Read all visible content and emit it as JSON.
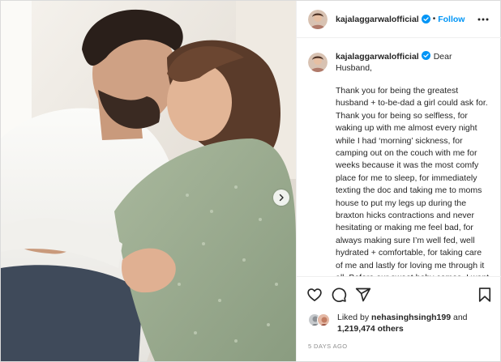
{
  "post": {
    "username": "kajalaggarwalofficial",
    "follow_label": "Follow",
    "separator": "•",
    "caption_greeting": "Dear Husband,",
    "caption_text": "Thank you for being the greatest husband + to-be-dad a girl could ask for. Thank you for being so selfless, for waking up with me almost every night while I had ‘morning’ sickness, for camping out on the couch with me for weeks because it was the most comfy place for me to sleep, for immediately texting the doc and taking me to moms house to put my legs up during the braxton hicks contractions and never hesitating or making me feel bad, for always making sure I’m well fed, well hydrated + comfortable, for taking care of me and lastly for loving me through it all. Before our sweet baby comes, I want",
    "liked_by_prefix": "Liked by",
    "liked_by_user": "nehasinghsingh199",
    "liked_by_and": "and",
    "likes_count": "1,219,474 others",
    "timestamp": "5 DAYS AGO"
  },
  "colors": {
    "accent": "#0095f6",
    "text": "#262626",
    "muted": "#8e8e8e",
    "border": "#dbdbdb"
  },
  "icons": {
    "verified": "verified-badge-icon",
    "more": "more-options-icon",
    "like": "heart-icon",
    "comment": "comment-icon",
    "share": "share-icon",
    "save": "bookmark-icon",
    "next": "chevron-right-icon"
  }
}
